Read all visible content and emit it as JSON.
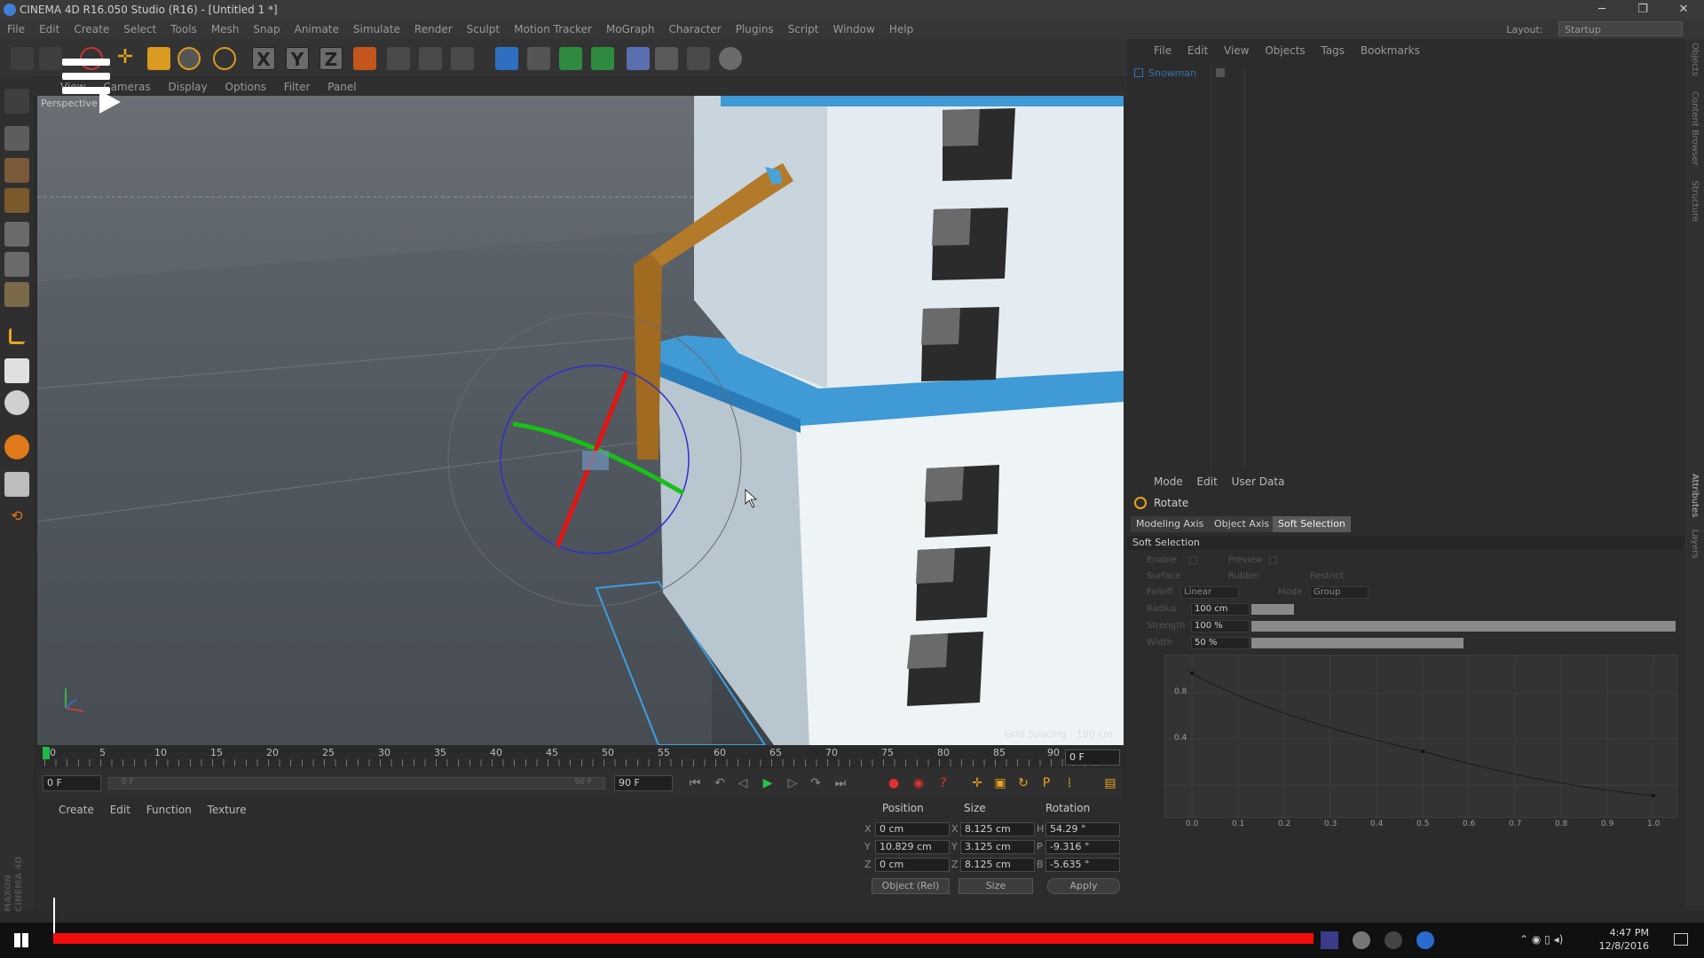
{
  "window": {
    "title": "CINEMA 4D R16.050 Studio (R16) - [Untitled 1 *]",
    "minimize": "─",
    "maximize": "❐",
    "close": "✕"
  },
  "menubar": {
    "items": [
      "File",
      "Edit",
      "Create",
      "Select",
      "Tools",
      "Mesh",
      "Snap",
      "Animate",
      "Simulate",
      "Render",
      "Sculpt",
      "Motion Tracker",
      "MoGraph",
      "Character",
      "Plugins",
      "Script",
      "Window",
      "Help"
    ],
    "layout_label": "Layout:",
    "layout_value": "Startup"
  },
  "toolbar": {
    "axis_x": "X",
    "axis_y": "Y",
    "axis_z": "Z"
  },
  "viewport": {
    "menu": [
      "View",
      "Cameras",
      "Display",
      "Options",
      "Filter",
      "Panel"
    ],
    "camera": "Perspective",
    "grid_spacing": "Grid Spacing : 100 cm"
  },
  "timeline": {
    "ticks": [
      "0",
      "5",
      "10",
      "15",
      "20",
      "25",
      "30",
      "35",
      "40",
      "45",
      "50",
      "55",
      "60",
      "65",
      "70",
      "75",
      "80",
      "85",
      "90"
    ],
    "current_frame_box": "0 F"
  },
  "transport": {
    "start_frame": "0 F",
    "range_start": "0 F",
    "range_end": "90 F",
    "end_frame": "90 F"
  },
  "material_manager": {
    "menu": [
      "Create",
      "Edit",
      "Function",
      "Texture"
    ]
  },
  "coordinates": {
    "headers": {
      "position": "Position",
      "size": "Size",
      "rotation": "Rotation"
    },
    "rows": [
      {
        "axis": "X",
        "pos": "0 cm",
        "size_axis": "X",
        "size": "8.125 cm",
        "rot_axis": "H",
        "rot": "54.29 °"
      },
      {
        "axis": "Y",
        "pos": "10.829 cm",
        "size_axis": "Y",
        "size": "3.125 cm",
        "rot_axis": "P",
        "rot": "-9.316 °"
      },
      {
        "axis": "Z",
        "pos": "0 cm",
        "size_axis": "Z",
        "size": "8.125 cm",
        "rot_axis": "B",
        "rot": "-5.635 °"
      }
    ],
    "mode_select": "Object (Rel)",
    "size_select": "Size",
    "apply": "Apply"
  },
  "object_manager": {
    "menu": [
      "File",
      "Edit",
      "View",
      "Objects",
      "Tags",
      "Bookmarks"
    ],
    "object_name": "Snowman"
  },
  "attributes": {
    "menu": [
      "Mode",
      "Edit",
      "User Data"
    ],
    "tool_name": "Rotate",
    "tabs": [
      "Modeling Axis",
      "Object Axis",
      "Soft Selection"
    ],
    "active_tab": "Soft Selection",
    "section": "Soft Selection",
    "enable": "Enable",
    "preview": "Preview",
    "surface": "Surface",
    "rubber": "Rubber",
    "restrict": "Restrict",
    "falloff": "Falloff",
    "falloff_value": "Linear",
    "mode": "Mode",
    "mode_value": "Group",
    "radius_label": "Radius",
    "radius": "100 cm",
    "radius_fraction": 0.1,
    "strength_label": "Strength",
    "strength": "100 %",
    "strength_fraction": 1.0,
    "width_label": "Width",
    "width": "50 %",
    "width_fraction": 0.5,
    "graph_y_ticks": [
      "0.8",
      "0.4"
    ],
    "graph_x_ticks": [
      "0.0",
      "0.1",
      "0.2",
      "0.3",
      "0.4",
      "0.5",
      "0.6",
      "0.7",
      "0.8",
      "0.9",
      "1.0"
    ]
  },
  "right_strip": {
    "tabs": [
      "Objects",
      "Content Browser",
      "Structure",
      "Attributes",
      "Layers"
    ]
  },
  "branding": {
    "maxon": "MAXON",
    "product": "CINEMA 4D"
  },
  "taskbar": {
    "time": "4:47 PM",
    "date": "12/8/2016"
  }
}
